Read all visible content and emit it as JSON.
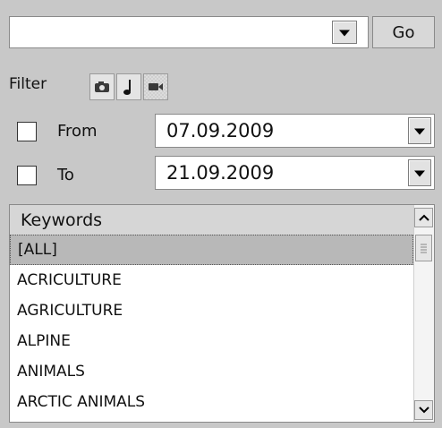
{
  "search": {
    "value": "",
    "go_label": "Go"
  },
  "filter": {
    "label": "Filter",
    "buttons": [
      {
        "icon": "camera-icon"
      },
      {
        "icon": "music-note-icon"
      },
      {
        "icon": "video-camera-icon"
      }
    ]
  },
  "date_range": {
    "from": {
      "label": "From",
      "value": "07.09.2009",
      "checked": false
    },
    "to": {
      "label": "To",
      "value": "21.09.2009",
      "checked": false
    }
  },
  "keywords": {
    "header": "Keywords",
    "selected": "[ALL]",
    "items": [
      "[ALL]",
      "ACRICULTURE",
      "AGRICULTURE",
      "ALPINE",
      "ANIMALS",
      "ARCTIC ANIMALS"
    ]
  },
  "colors": {
    "background": "#c8c8c8",
    "selected_row": "#b8b8b8",
    "header": "#d6d6d6"
  }
}
